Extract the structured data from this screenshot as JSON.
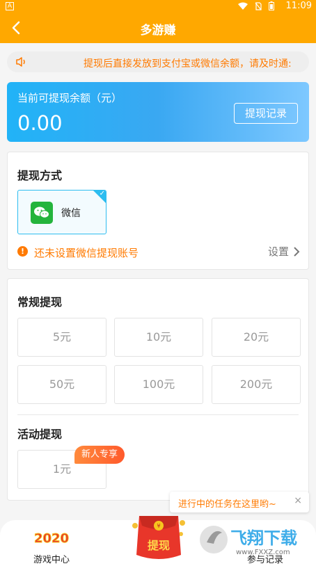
{
  "status_bar": {
    "time": "11:09",
    "left_icon": "A"
  },
  "header": {
    "title": "多游赚"
  },
  "notice": {
    "text": "提现后直接发放到支付宝或微信余额，请及时通:"
  },
  "balance": {
    "label": "当前可提现余额（元）",
    "amount": "0.00",
    "record_button": "提现记录"
  },
  "method": {
    "title": "提现方式",
    "option": "微信",
    "warning": "还未设置微信提现账号",
    "setting": "设置",
    "warning_icon": "!"
  },
  "regular": {
    "title": "常规提现",
    "amounts": [
      "5元",
      "10元",
      "20元",
      "50元",
      "100元",
      "200元"
    ]
  },
  "activity": {
    "title": "活动提现",
    "amount": "1元",
    "badge": "新人专享"
  },
  "tooltip": {
    "text": "进行中的任务在这里哟~",
    "close": "×"
  },
  "tabbar": {
    "left_label": "游戏中心",
    "left_icon_text": "2020",
    "center_label": "提现",
    "right_label": "参与记录"
  },
  "watermark": {
    "text": "飞翔下载",
    "url": "www.FXXZ.com"
  },
  "colors": {
    "primary": "#ffa800",
    "accent": "#ff7a00",
    "blue": "#2dbdf0",
    "wechat": "#24b43c"
  }
}
